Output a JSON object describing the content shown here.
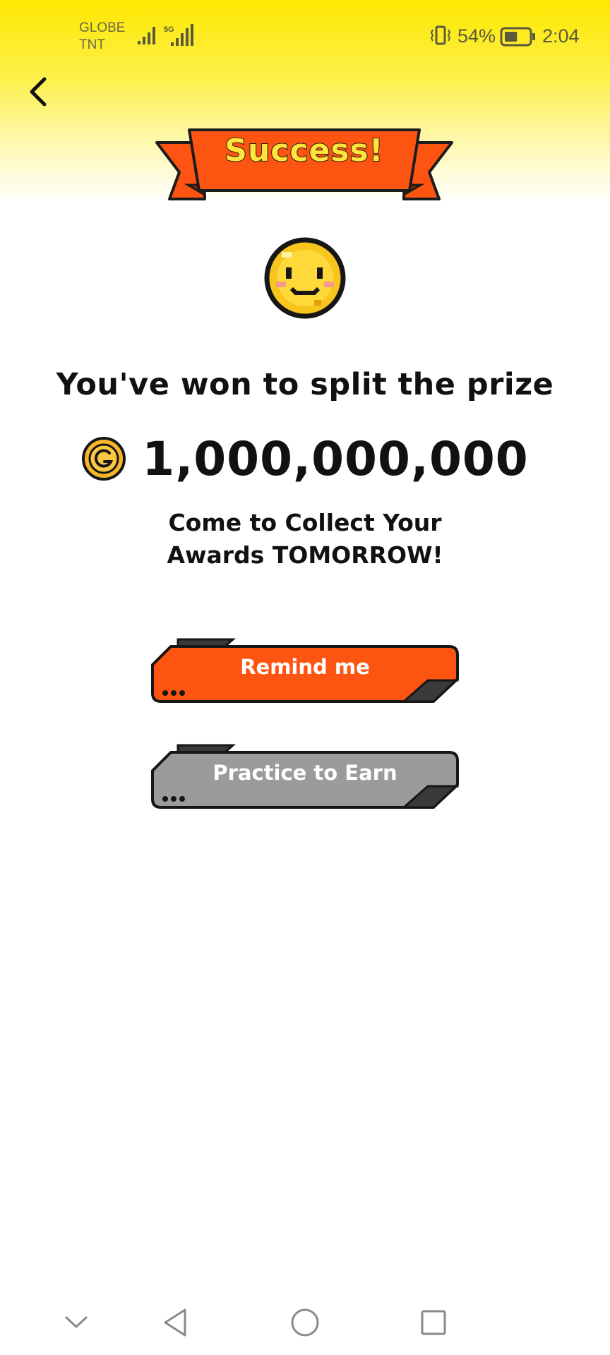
{
  "status_bar": {
    "carrier_line1": "GLOBE",
    "carrier_line2": "TNT",
    "network_label": "5G",
    "battery_percent": "54%",
    "time": "2:04",
    "battery_level": 0.54
  },
  "banner": {
    "title": "Success!"
  },
  "headline": "You've won to split the prize",
  "prize": {
    "amount": "1,000,000,000",
    "coin_icon": "coin-g-icon"
  },
  "subtext": {
    "line1": "Come to Collect Your",
    "line2": "Awards TOMORROW!"
  },
  "buttons": {
    "remind": {
      "label": "Remind me",
      "color": "#fe5412"
    },
    "practice": {
      "label": "Practice to Earn",
      "color": "#9b9b9b"
    }
  },
  "nav": {
    "icons": [
      "chevron-down-icon",
      "back-triangle-icon",
      "home-circle-icon",
      "recent-square-icon"
    ]
  },
  "colors": {
    "header_yellow": "#fde800",
    "accent_orange": "#fe5412",
    "banner_text": "#ffe43c"
  }
}
